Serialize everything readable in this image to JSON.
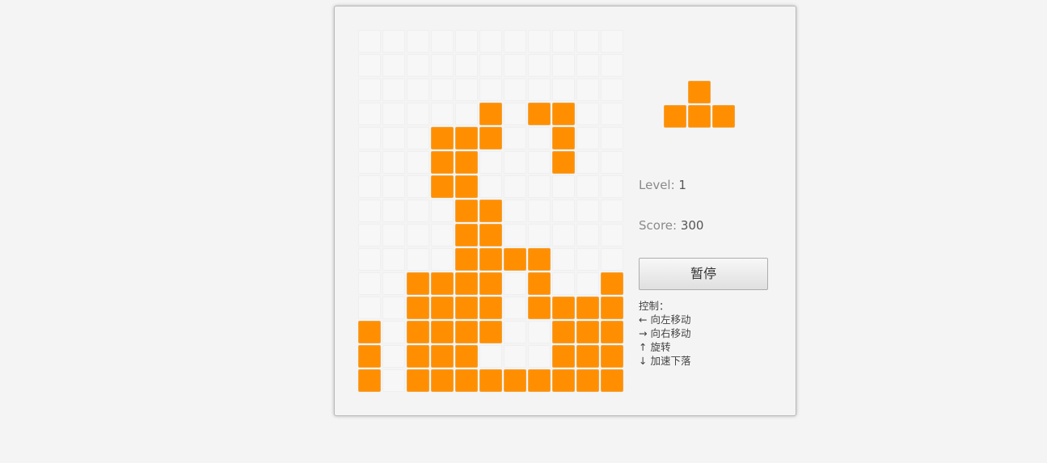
{
  "game": {
    "columns": 11,
    "rows": 15,
    "accent_color": "#ff8f00",
    "empty_color": "#f7f7f7",
    "board": [
      "...........",
      "...........",
      "...........",
      ".....#.##..",
      "...###..#..",
      "...##...#..",
      "...##......",
      "....##.....",
      "....##.....",
      "....####...",
      "..####.#..#",
      "..####.####",
      "#.####..###",
      "#.###...###",
      "#.#########"
    ],
    "next_piece": [
      ".#.",
      "###"
    ]
  },
  "stats": {
    "level_label": "Level: ",
    "level_value": "1",
    "score_label": "Score: ",
    "score_value": "300"
  },
  "pause_button": {
    "label": "暂停"
  },
  "controls": {
    "title": "控制：",
    "left": "← 向左移动",
    "right": "→ 向右移动",
    "rotate": "↑ 旋转",
    "drop": "↓ 加速下落"
  }
}
